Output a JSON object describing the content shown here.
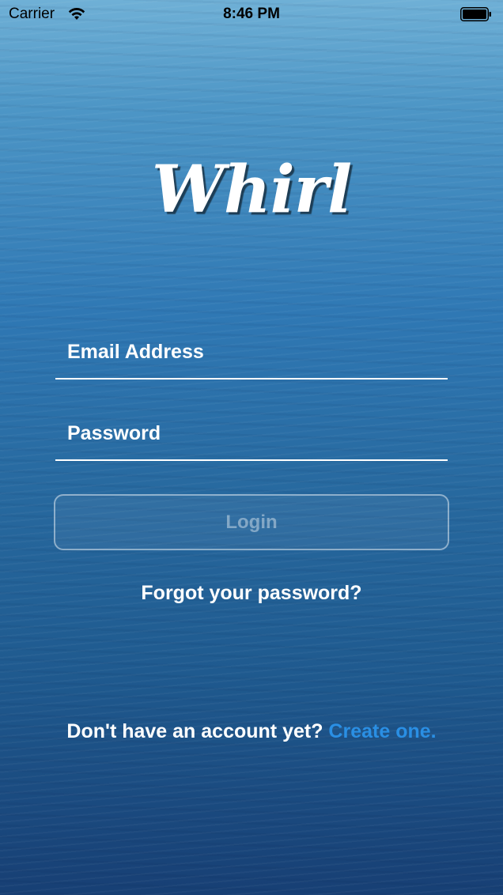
{
  "status_bar": {
    "carrier": "Carrier",
    "time": "8:46 PM",
    "wifi_icon": "wifi-icon",
    "battery_icon": "battery-icon"
  },
  "app": {
    "logo_text": "Whirl"
  },
  "form": {
    "email_placeholder": "Email Address",
    "password_placeholder": "Password",
    "login_label": "Login",
    "forgot_label": "Forgot your password?"
  },
  "signup": {
    "prompt": "Don't have an account yet?",
    "link_label": "Create one."
  },
  "colors": {
    "link": "#2a8fe4",
    "text": "#ffffff",
    "background_top": "#6fb0d6",
    "background_bottom": "#173f74"
  }
}
